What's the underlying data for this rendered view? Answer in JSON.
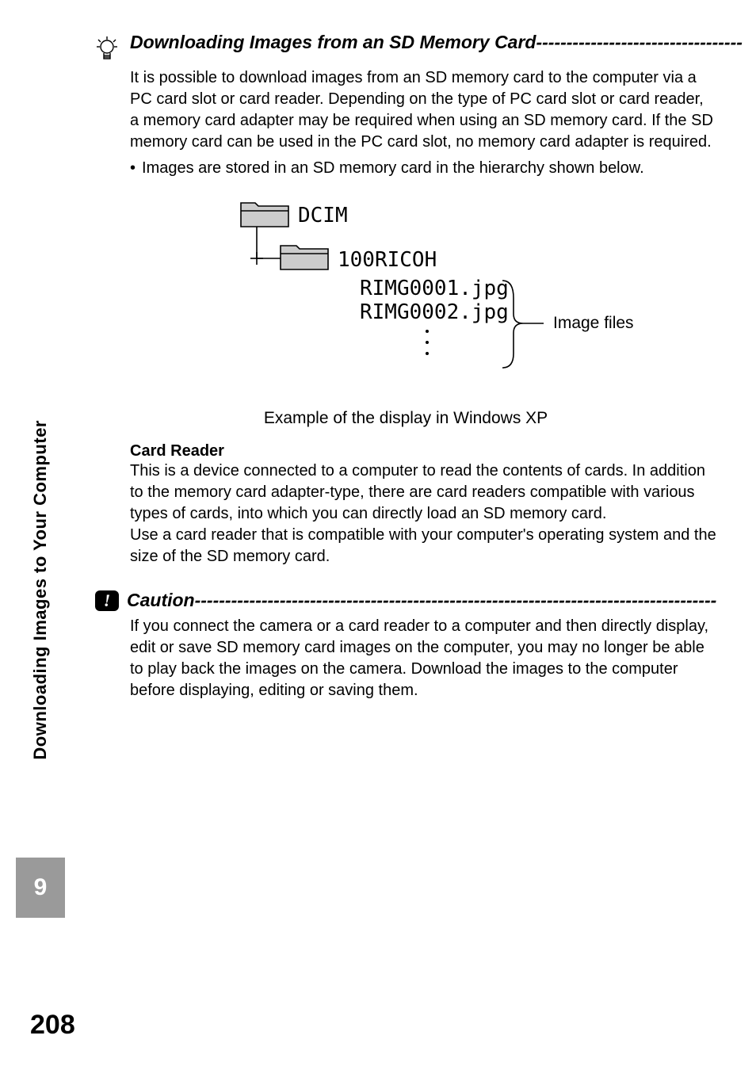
{
  "tip": {
    "heading": "Downloading Images from an SD Memory Card",
    "heading_dashes": "----------------------------------",
    "body": "It is possible to download images from an SD memory card to the computer via a PC card slot or card reader. Depending on the type of PC card slot or card reader, a memory card adapter may be required when using an SD memory card. If the SD memory card can be used in the PC card slot, no memory card adapter is required.",
    "bullet": "Images are stored in an SD memory card in the hierarchy shown below."
  },
  "diagram": {
    "folder1": "DCIM",
    "folder2": "100RICOH",
    "file1": "RIMG0001.jpg",
    "file2": "RIMG0002.jpg",
    "brace_label": "Image files",
    "caption": "Example of the display in Windows XP"
  },
  "card_reader": {
    "title": "Card Reader",
    "body1": "This is a device connected to a computer to read the contents of cards. In addition to the memory card adapter-type, there are card readers compatible with various types of cards, into which you can directly load an SD memory card.",
    "body2": "Use a card reader that is compatible with your computer's operating system and the size of the SD memory card."
  },
  "caution": {
    "heading": "Caution",
    "dashes": "-------------------------------------------------------------------------------------------",
    "body": "If you connect the camera or a card reader to a computer and then directly display, edit or save SD memory card images on the computer, you may no longer be able to play back the images on the camera. Download the images to the computer before displaying, editing or saving them."
  },
  "sidebar": {
    "label": "Downloading Images to Your Computer",
    "tab": "9"
  },
  "page_number": "208"
}
